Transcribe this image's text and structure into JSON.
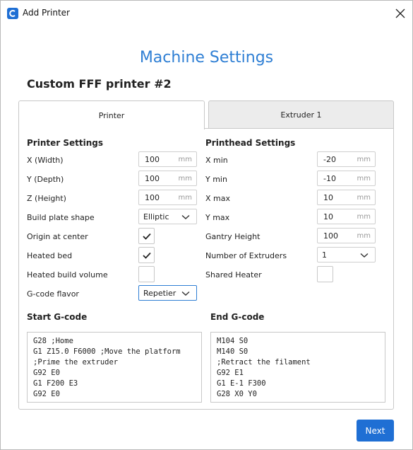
{
  "window": {
    "title": "Add Printer",
    "accent": "#1f6fd4"
  },
  "heading": "Machine Settings",
  "printer_name": "Custom FFF printer #2",
  "tabs": [
    {
      "label": "Printer",
      "active": true
    },
    {
      "label": "Extruder 1",
      "active": false
    }
  ],
  "printer_settings": {
    "title": "Printer Settings",
    "x_width": {
      "label": "X (Width)",
      "value": "100",
      "unit": "mm"
    },
    "y_depth": {
      "label": "Y (Depth)",
      "value": "100",
      "unit": "mm"
    },
    "z_height": {
      "label": "Z (Height)",
      "value": "100",
      "unit": "mm"
    },
    "build_plate_shape": {
      "label": "Build plate shape",
      "value": "Elliptic"
    },
    "origin_at_center": {
      "label": "Origin at center",
      "checked": true
    },
    "heated_bed": {
      "label": "Heated bed",
      "checked": true
    },
    "heated_build_volume": {
      "label": "Heated build volume",
      "checked": false
    },
    "gcode_flavor": {
      "label": "G-code flavor",
      "value": "Repetier"
    }
  },
  "printhead_settings": {
    "title": "Printhead Settings",
    "x_min": {
      "label": "X min",
      "value": "-20",
      "unit": "mm"
    },
    "y_min": {
      "label": "Y min",
      "value": "-10",
      "unit": "mm"
    },
    "x_max": {
      "label": "X max",
      "value": "10",
      "unit": "mm"
    },
    "y_max": {
      "label": "Y max",
      "value": "10",
      "unit": "mm"
    },
    "gantry_height": {
      "label": "Gantry Height",
      "value": "100",
      "unit": "mm"
    },
    "number_of_extruders": {
      "label": "Number of Extruders",
      "value": "1"
    },
    "shared_heater": {
      "label": "Shared Heater",
      "checked": false
    }
  },
  "start_gcode": {
    "title": "Start G-code",
    "lines": "G28 ;Home\nG1 Z15.0 F6000 ;Move the platform\n;Prime the extruder\nG92 E0\nG1 F200 E3\nG92 E0"
  },
  "end_gcode": {
    "title": "End G-code",
    "lines": "M104 S0\nM140 S0\n;Retract the filament\nG92 E1\nG1 E-1 F300\nG28 X0 Y0"
  },
  "next_label": "Next"
}
